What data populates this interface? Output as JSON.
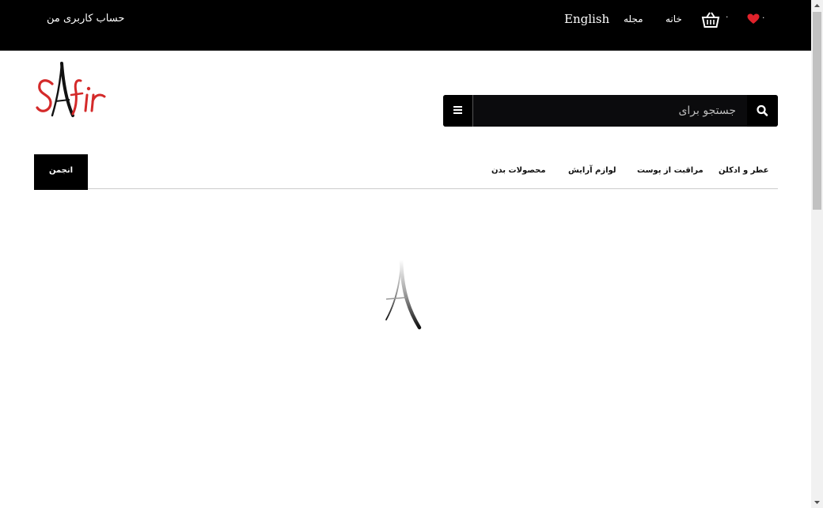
{
  "topbar": {
    "account_label": "حساب کاربری من",
    "language_label": "English",
    "magazine_label": "مجله",
    "home_label": "خانه",
    "cart_count": "۰",
    "wishlist_count": "۰",
    "wishlist_color": "#e0222b"
  },
  "logo": {
    "text": "SAfir",
    "accent_color": "#d42a2a"
  },
  "search": {
    "placeholder": "جستجو برای"
  },
  "nav": {
    "items": [
      "عطر و ادکلن",
      "مراقبت از پوست",
      "لوازم آرایش",
      "محصولات بدن"
    ],
    "forum_label": "انجمن"
  }
}
